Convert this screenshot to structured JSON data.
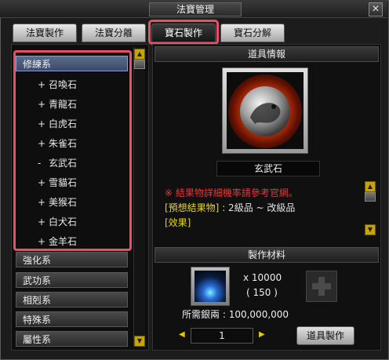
{
  "window": {
    "title": "法寶管理",
    "close_label": "✕"
  },
  "tabs": [
    {
      "label": "法寶製作"
    },
    {
      "label": "法寶分離"
    },
    {
      "label": "寶石製作"
    },
    {
      "label": "寶石分解"
    }
  ],
  "left": {
    "open_category": "修練系",
    "sub_items": [
      {
        "marker": "+",
        "label": "召喚石"
      },
      {
        "marker": "+",
        "label": "青龍石"
      },
      {
        "marker": "+",
        "label": "白虎石"
      },
      {
        "marker": "+",
        "label": "朱雀石"
      },
      {
        "marker": "-",
        "label": "玄武石"
      },
      {
        "marker": "+",
        "label": "雪貓石"
      },
      {
        "marker": "+",
        "label": "美猴石"
      },
      {
        "marker": "+",
        "label": "白犬石"
      },
      {
        "marker": "+",
        "label": "金羊石"
      }
    ],
    "categories": [
      "強化系",
      "武功系",
      "相剋系",
      "特殊系",
      "屬性系"
    ]
  },
  "item_info": {
    "header": "道具情報",
    "item_name": "玄武石",
    "warn_mark": "※",
    "warn_text": "結果物詳細機率請參考官網。",
    "result_label": "[預想結果物]",
    "result_value": ": 2級品 ~ 改級品",
    "effect_label": "[效果]"
  },
  "material": {
    "header": "製作材料",
    "count": "x 10000",
    "owned": "( 150 )",
    "cost_label": "所需銀兩",
    "cost_value": ": 100,000,000",
    "quantity": "1",
    "make_button": "道具製作"
  },
  "colors": {
    "highlight": "#e8506a",
    "scroll": "#c8a400",
    "warning": "#e03a3a",
    "info_yellow": "#e8d800"
  }
}
